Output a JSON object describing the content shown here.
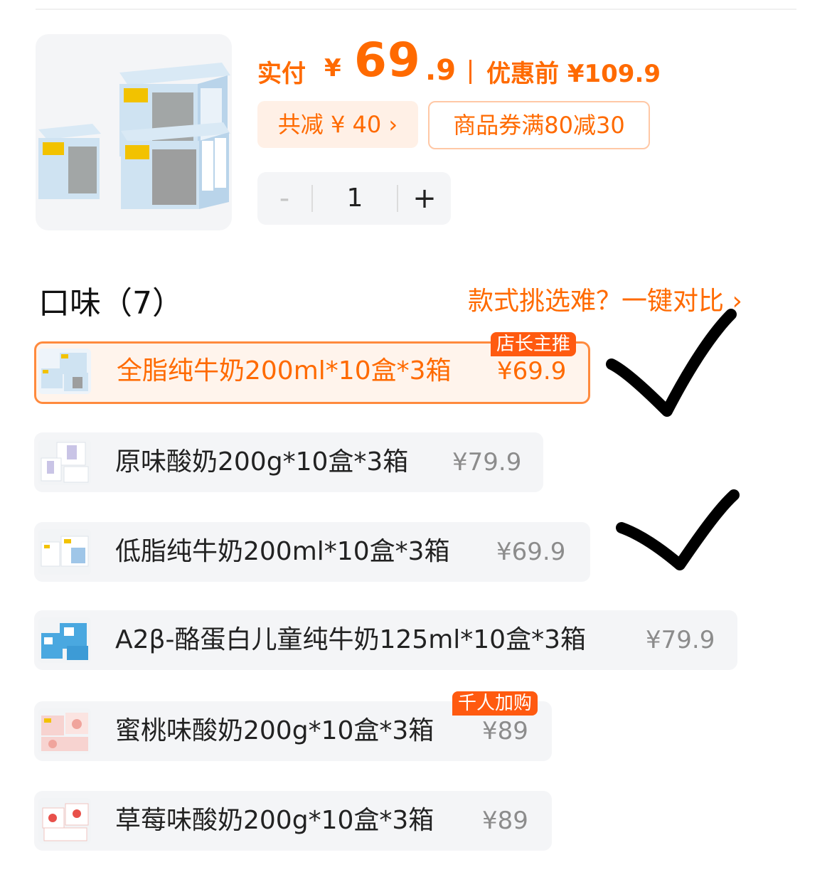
{
  "header": {
    "price_label": "实付",
    "currency": "¥",
    "price_integer": "69",
    "price_decimal": ".9",
    "original_price": "优惠前 ¥109.9"
  },
  "tags": {
    "discount": "共减 ¥ 40 ›",
    "coupon": "商品券满80减30"
  },
  "stepper": {
    "minus": "-",
    "quantity": "1",
    "plus": "+"
  },
  "section": {
    "title": "口味（7）",
    "compare_link": "款式挑选难？一键对比 ›"
  },
  "options": [
    {
      "name": "全脂纯牛奶200ml*10盒*3箱",
      "price": "¥69.9",
      "badge": "店长主推",
      "selected": true
    },
    {
      "name": "原味酸奶200g*10盒*3箱",
      "price": "¥79.9"
    },
    {
      "name": "低脂纯牛奶200ml*10盒*3箱",
      "price": "¥69.9"
    },
    {
      "name": "A2β-酪蛋白儿童纯牛奶125ml*10盒*3箱",
      "price": "¥79.9"
    },
    {
      "name": "蜜桃味酸奶200g*10盒*3箱",
      "price": "¥89",
      "badge": "千人加购"
    },
    {
      "name": "草莓味酸奶200g*10盒*3箱",
      "price": "¥89"
    }
  ],
  "icons": {
    "product_image": "milk-box-image",
    "checkmarks": "handwritten-checkmark-icon"
  },
  "colors": {
    "accent": "#ff6a00",
    "badge": "#ff5a10",
    "selected_bg": "#fff4ec",
    "option_bg": "#f4f5f7"
  }
}
